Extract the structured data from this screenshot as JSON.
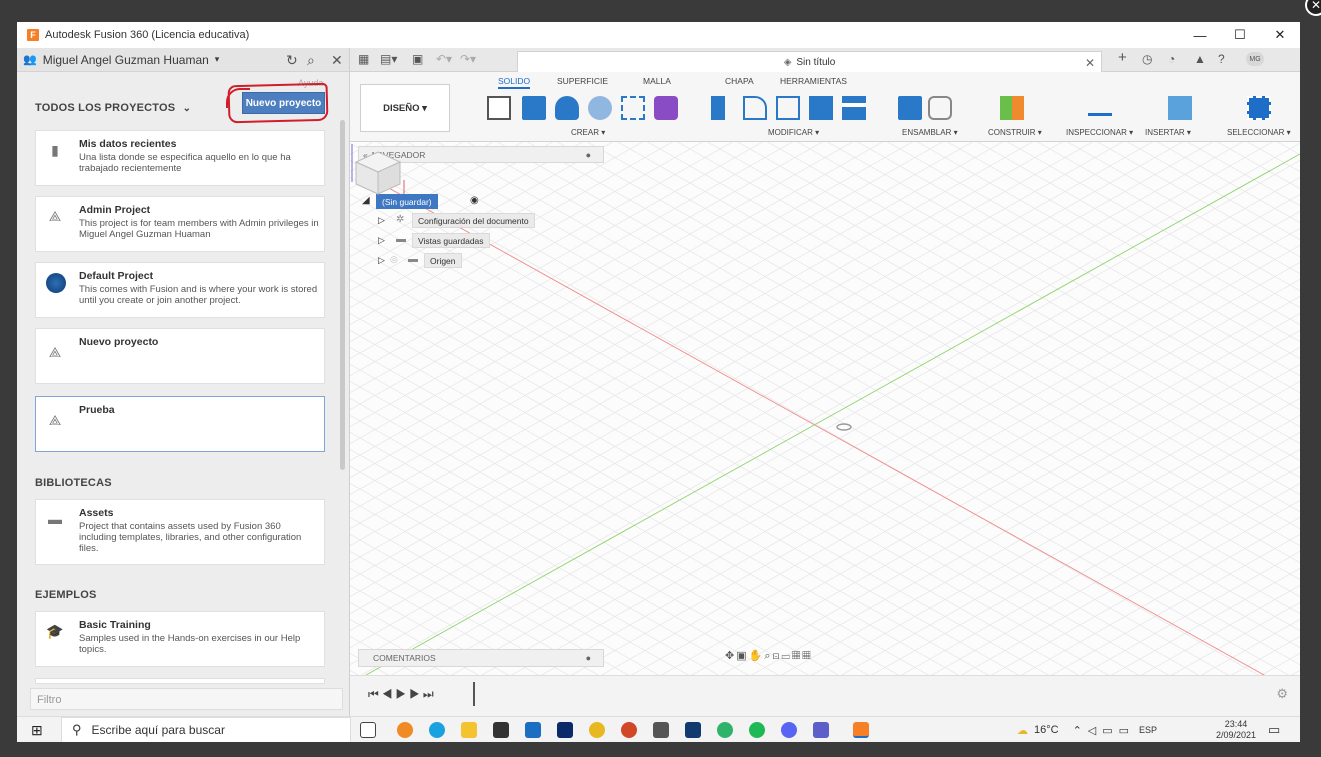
{
  "window": {
    "title": "Autodesk Fusion 360 (Licencia educativa)",
    "app_icon": "F",
    "controls": {
      "minimize": "—",
      "maximize": "☐",
      "close": "✕"
    }
  },
  "left_panel": {
    "user_name": "Miguel Angel Guzman Huaman",
    "all_projects_label": "TODOS LOS PROYECTOS",
    "new_project_button": "Nuevo proyecto",
    "faint_hint": "Ayuda",
    "projects": [
      {
        "title": "Mis datos recientes",
        "description": "Una lista donde se especifica aquello en lo que ha trabajado recientemente",
        "icon": "document-icon"
      },
      {
        "title": "Admin Project",
        "description": "This project is for team members with Admin privileges in Miguel Angel Guzman Huaman",
        "icon": "project-icon"
      },
      {
        "title": "Default Project",
        "description": "This comes with Fusion and is where your work is stored until you create or join another project.",
        "icon": "fusion-logo-icon"
      },
      {
        "title": "Nuevo proyecto",
        "description": "",
        "icon": "project-icon"
      },
      {
        "title": "Prueba",
        "description": "",
        "icon": "project-icon"
      }
    ],
    "libraries_label": "BIBLIOTECAS",
    "libraries": [
      {
        "title": "Assets",
        "description": "Project that contains assets used by Fusion 360 including templates, libraries, and other configuration files.",
        "icon": "archive-icon"
      }
    ],
    "examples_label": "EJEMPLOS",
    "examples": [
      {
        "title": "Basic Training",
        "description": "Samples used in the Hands-on exercises in our Help topics.",
        "icon": "graduation-cap-icon"
      }
    ],
    "filter_placeholder": "Filtro"
  },
  "document_tab": {
    "title": "Sin título",
    "user_initials": "MG"
  },
  "ribbon": {
    "workspace": "DISEÑO ▾",
    "tabs": [
      "SOLIDO",
      "SUPERFICIE",
      "MALLA",
      "CHAPA",
      "HERRAMIENTAS"
    ],
    "active_tab": "SOLIDO",
    "groups": [
      "CREAR ▾",
      "MODIFICAR ▾",
      "ENSAMBLAR ▾",
      "CONSTRUIR ▾",
      "INSPECCIONAR ▾",
      "INSERTAR ▾",
      "SELECCIONAR ▾"
    ]
  },
  "browser": {
    "header": "NAVEGADOR",
    "root": "(Sin guardar)",
    "items": [
      "Configuración del documento",
      "Vistas guardadas",
      "Origen"
    ]
  },
  "comments_label": "COMENTARIOS",
  "taskbar": {
    "search_placeholder": "Escribe aquí para buscar",
    "weather": "16°C",
    "language": "ESP",
    "time": "23:44",
    "date": "2/09/2021"
  },
  "colors": {
    "accent_blue": "#1e6ec8",
    "button_blue": "#4d7fc0",
    "annotation_red": "#d01e2a",
    "axis_green": "#8fd36b",
    "axis_red": "#f08a8a"
  }
}
